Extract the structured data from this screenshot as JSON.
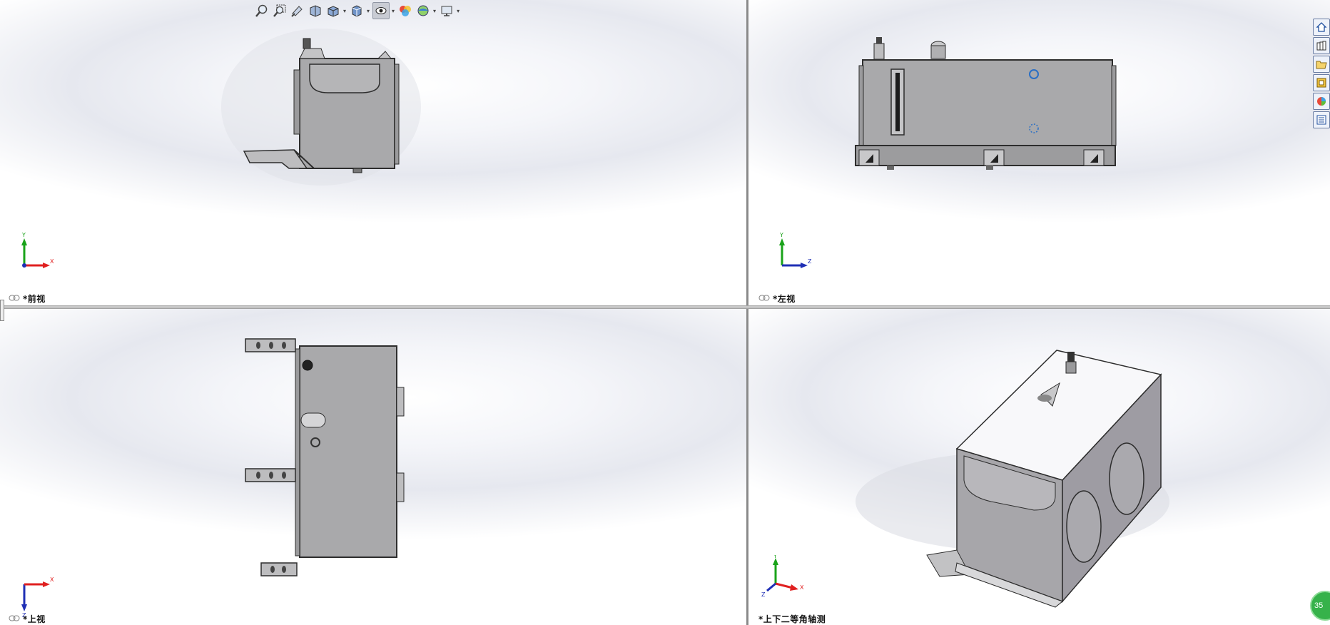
{
  "viewports": [
    {
      "label": "*前视",
      "triad": {
        "up": "Y",
        "right": "X"
      }
    },
    {
      "label": "*左视",
      "triad": {
        "up": "Y",
        "right": "Z"
      }
    },
    {
      "label": "*上视",
      "triad": {
        "down": "Z",
        "right": "X"
      }
    },
    {
      "label": "*上下二等角轴测",
      "triad": {
        "up": "Y",
        "right": "X",
        "left": "Z"
      }
    }
  ],
  "toolbar": {
    "icons": [
      "zoom-to-fit-icon",
      "zoom-to-area-icon",
      "previous-view-icon",
      "section-view-icon",
      "view-orientation-icon",
      "display-style-icon",
      "hide-show-items-icon",
      "edit-appearance-icon",
      "apply-scene-icon",
      "view-settings-icon"
    ]
  },
  "task_pane": {
    "icons": [
      "home-icon",
      "design-library-icon",
      "file-explorer-icon",
      "view-palette-icon",
      "appearances-icon",
      "custom-properties-icon"
    ]
  },
  "badge": {
    "text": "35"
  },
  "colors": {
    "part": "#a9a9ab",
    "outline": "#2d2d2d",
    "triad_x": "#e02020",
    "triad_y": "#1aa31a",
    "triad_z": "#1f2fb5"
  }
}
